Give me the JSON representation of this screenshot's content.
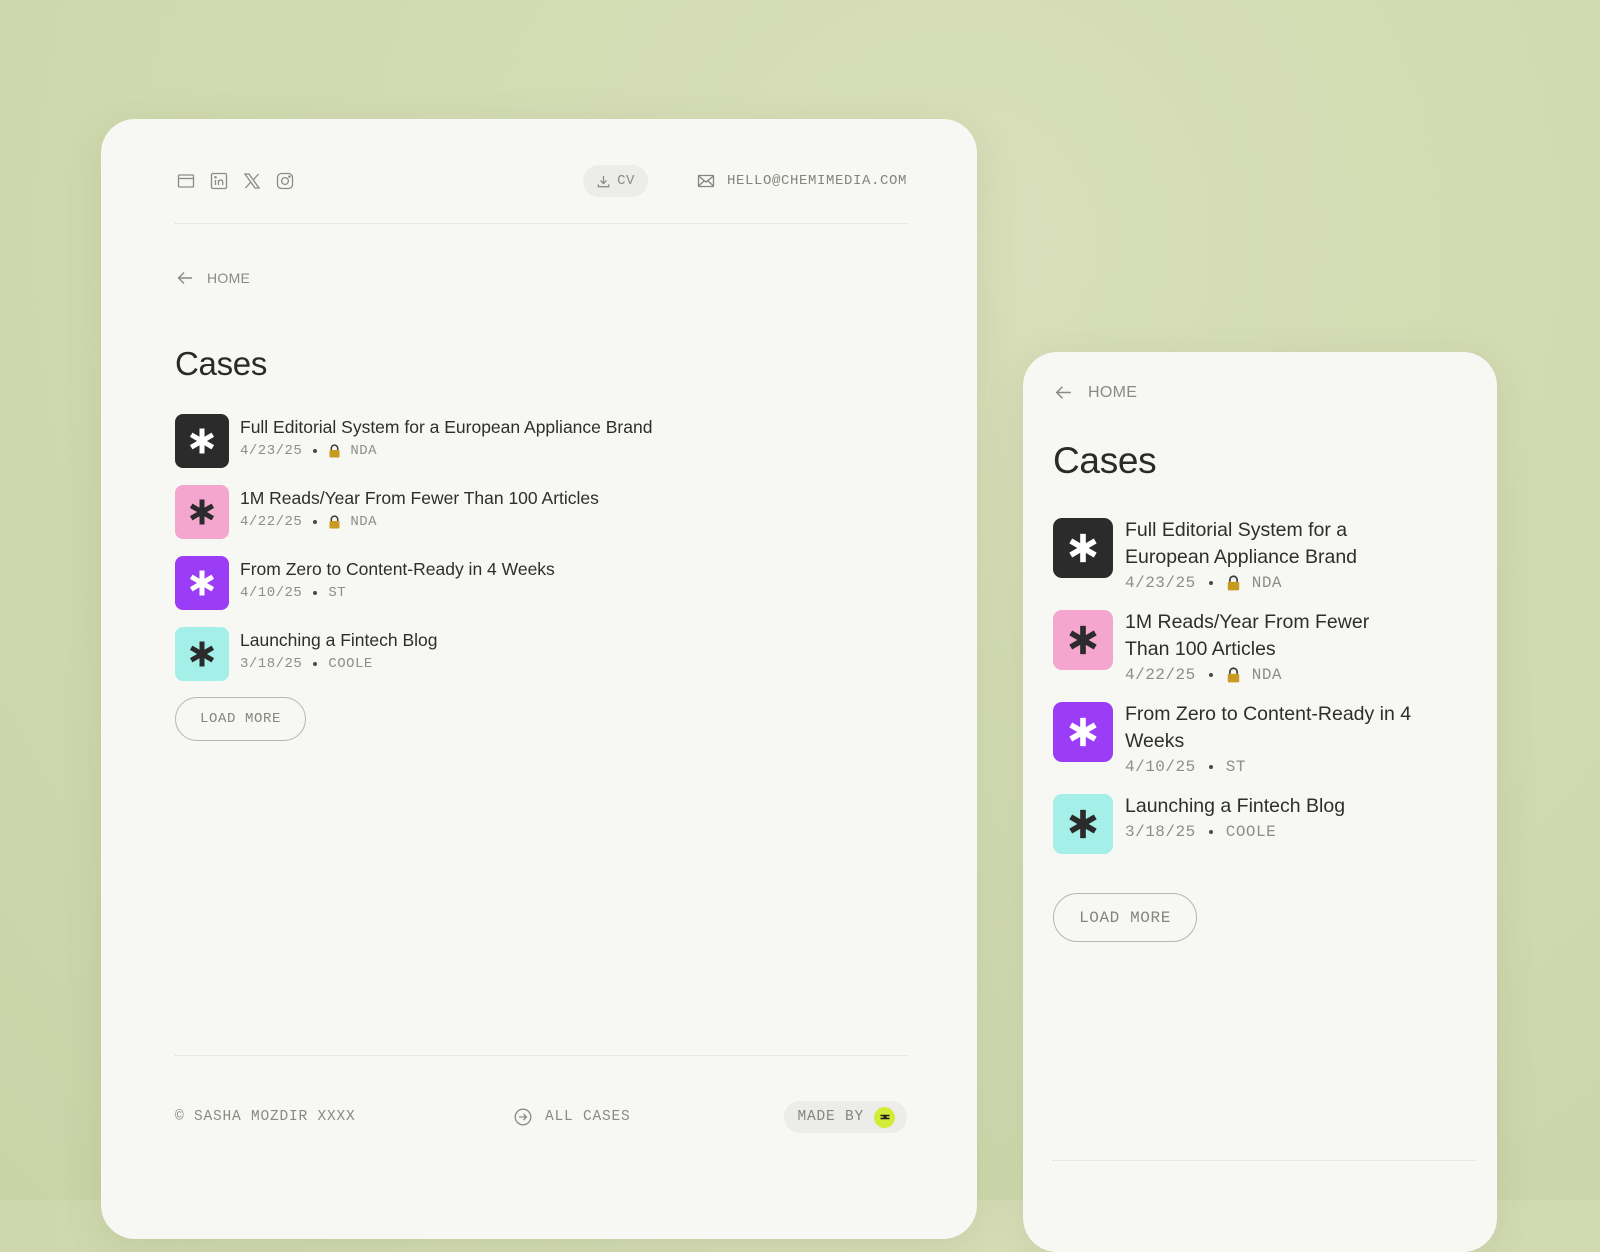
{
  "header": {
    "socials": [
      {
        "icon": "browser-window-icon"
      },
      {
        "icon": "linkedin-icon"
      },
      {
        "icon": "x-icon"
      },
      {
        "icon": "instagram-icon"
      }
    ],
    "cv_label": "CV",
    "email": "HELLO@CHEMIMEDIA.COM"
  },
  "nav": {
    "home_label": "HOME"
  },
  "page": {
    "title": "Cases"
  },
  "cases": [
    {
      "title": "Full Editorial System for a European Appliance Brand",
      "date": "4/23/25",
      "tag": "NDA",
      "locked": true,
      "icon_bg": "#2b2b2b",
      "icon_fg": "#ffffff"
    },
    {
      "title": "1M Reads/Year From Fewer Than 100 Articles",
      "date": "4/22/25",
      "tag": "NDA",
      "locked": true,
      "icon_bg": "#f4a6cf",
      "icon_fg": "#2b2b2b"
    },
    {
      "title": "From Zero to Content-Ready in 4 Weeks",
      "date": "4/10/25",
      "tag": "ST",
      "locked": false,
      "icon_bg": "#9b3cf6",
      "icon_fg": "#ffffff"
    },
    {
      "title": "Launching a Fintech Blog",
      "date": "3/18/25",
      "tag": "COOLE",
      "locked": false,
      "icon_bg": "#a4efe7",
      "icon_fg": "#2b2b2b"
    }
  ],
  "load_more_label": "LOAD MORE",
  "footer": {
    "copyright": "© SASHA MOZDIR XXXX",
    "all_cases_label": "ALL CASES",
    "made_by_label": "MADE BY"
  },
  "colors": {
    "background": "#d3dbb3",
    "card": "#f7f7f3",
    "made_by_logo": "#d3ec38"
  }
}
